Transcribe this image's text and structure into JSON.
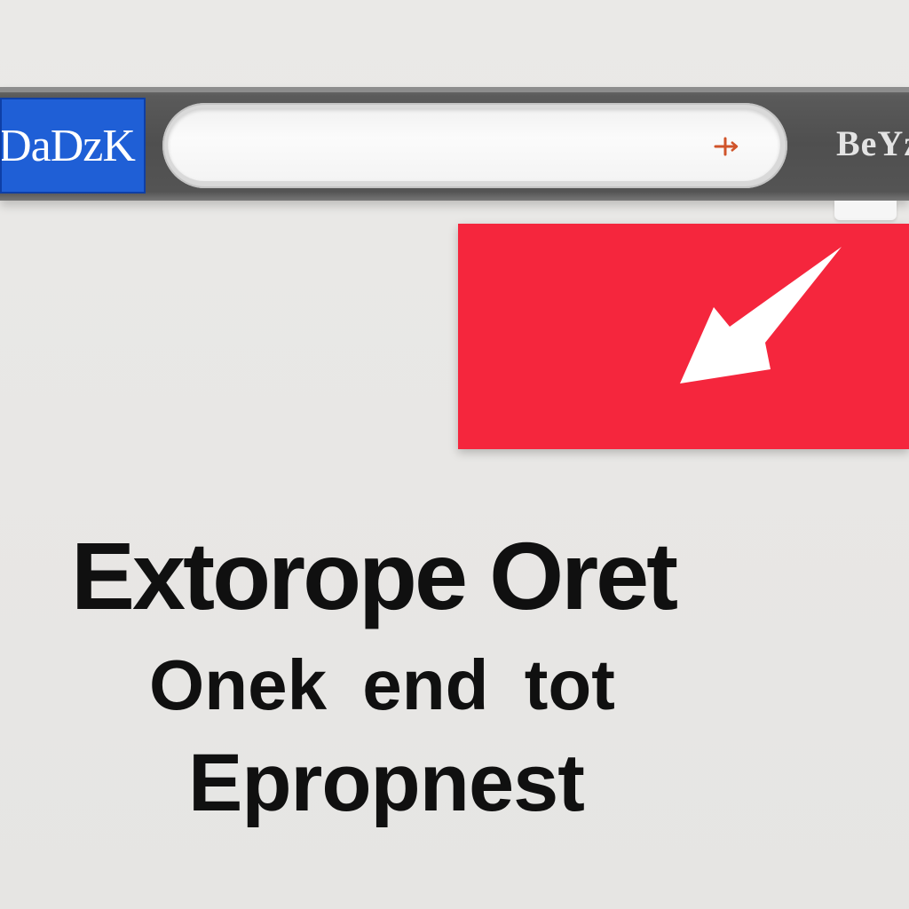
{
  "toolbar": {
    "logo_text": "DaDzK",
    "search": {
      "value": "",
      "placeholder": ""
    },
    "search_action_icon": "plus-arrow-icon",
    "right_label": "BeYz",
    "accent_color": "#1f5fd6"
  },
  "card": {
    "icon": "arrow-down-left-icon",
    "color": "#f5263d"
  },
  "headline": {
    "line1": "Extorope Oret",
    "line2": "Onek end tot",
    "line3": "Epropnest"
  }
}
